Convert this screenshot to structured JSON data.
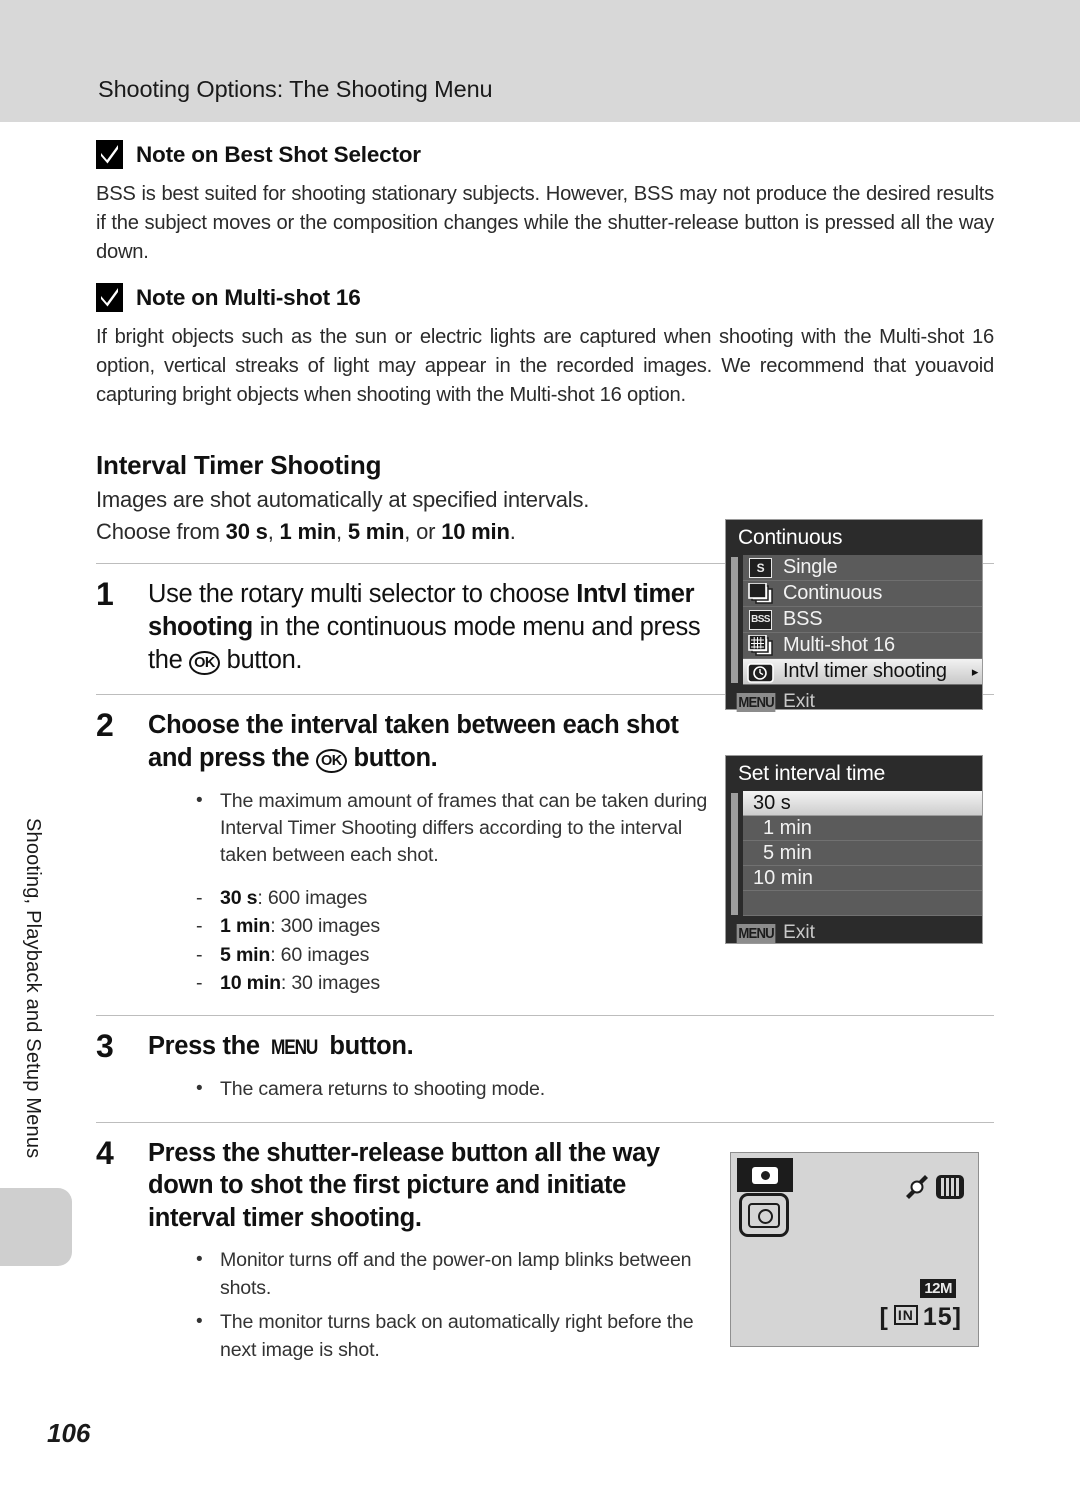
{
  "header": {
    "title": "Shooting Options: The Shooting Menu"
  },
  "side_tab": {
    "label": "Shooting, Playback and Setup Menus"
  },
  "page_number": "106",
  "notes": [
    {
      "icon": "check-mark-icon",
      "title": "Note on Best Shot Selector",
      "body": "BSS is best suited for shooting stationary subjects. However, BSS may not produce the desired results if the subject moves or the composition changes while the shutter-release button is pressed all the way down."
    },
    {
      "icon": "check-mark-icon",
      "title": "Note on Multi-shot 16",
      "body": "If bright objects such as the sun or electric lights are captured when shooting with the Multi-shot 16 option, vertical streaks of light may appear in the recorded images. We recommend that youavoid capturing bright objects when shooting with the Multi-shot 16 option."
    }
  ],
  "section": {
    "title": "Interval Timer Shooting",
    "lead": "Images are shot automatically at specified intervals.",
    "choose_prefix": "Choose from ",
    "choose_a": "30 s",
    "choose_sep1": ", ",
    "choose_b": "1 min",
    "choose_sep2": ", ",
    "choose_c": "5 min",
    "choose_sep3": ", or ",
    "choose_d": "10 min",
    "choose_end": "."
  },
  "steps": [
    {
      "num": "1",
      "title_a": "Use the rotary multi selector to choose ",
      "title_b": "Intvl timer shooting",
      "title_c": " in the continuous mode menu and press the ",
      "glyph": "OK",
      "title_d": " button."
    },
    {
      "num": "2",
      "title_a": "Choose the interval taken between each shot and press the ",
      "glyph": "OK",
      "title_d": " button.",
      "bullet": "The maximum amount of frames that can be taken during Interval Timer Shooting differs according to the interval taken between each shot.",
      "dash_items": [
        {
          "bold": "30 s",
          "rest": ": 600 images"
        },
        {
          "bold": "1 min",
          "rest": ": 300 images"
        },
        {
          "bold": "5 min",
          "rest": ": 60 images"
        },
        {
          "bold": "10 min",
          "rest": ": 30 images"
        }
      ]
    },
    {
      "num": "3",
      "title_a": "Press the ",
      "glyph": "MENU",
      "title_d": " button.",
      "bullet": "The camera returns to shooting mode."
    },
    {
      "num": "4",
      "title_a": "Press the shutter-release button all the way down to shot the first picture and initiate interval timer shooting.",
      "bullet1": "Monitor turns off and the power-on lamp blinks between shots.",
      "bullet2": "The monitor turns back on automatically right before the next image is shot."
    }
  ],
  "lcd_continuous": {
    "title": "Continuous",
    "rows": [
      {
        "icon": "single-shot-icon",
        "icon_text": "S",
        "label": "Single",
        "selected": false,
        "arrow": ""
      },
      {
        "icon": "continuous-stack-icon",
        "icon_text": "",
        "label": "Continuous",
        "selected": false,
        "arrow": ""
      },
      {
        "icon": "bss-icon",
        "icon_text": "BSS",
        "label": "BSS",
        "selected": false,
        "arrow": ""
      },
      {
        "icon": "multishot-grid-icon",
        "icon_text": "",
        "label": "Multi-shot 16",
        "selected": false,
        "arrow": ""
      },
      {
        "icon": "intvl-timer-icon",
        "icon_text": "",
        "label": "Intvl timer shooting",
        "selected": true,
        "arrow": "▸"
      }
    ],
    "footer_button": "MENU",
    "footer_label": "Exit"
  },
  "lcd_interval": {
    "title": "Set interval time",
    "rows": [
      {
        "label": "30 s",
        "selected": true
      },
      {
        "label": "1 min",
        "selected": false
      },
      {
        "label": "5 min",
        "selected": false
      },
      {
        "label": "10 min",
        "selected": false
      }
    ],
    "footer_button": "MENU",
    "footer_label": "Exit"
  },
  "lcd_shooting": {
    "mode_icon": "auto-camera-mode-icon",
    "timer_icon": "intvl-timer-indicator-icon",
    "af_icon": "af-assist-icon",
    "vr_icon": "vibration-reduction-icon",
    "image_size": "12M",
    "memory": "IN",
    "shots_remaining": "15"
  }
}
